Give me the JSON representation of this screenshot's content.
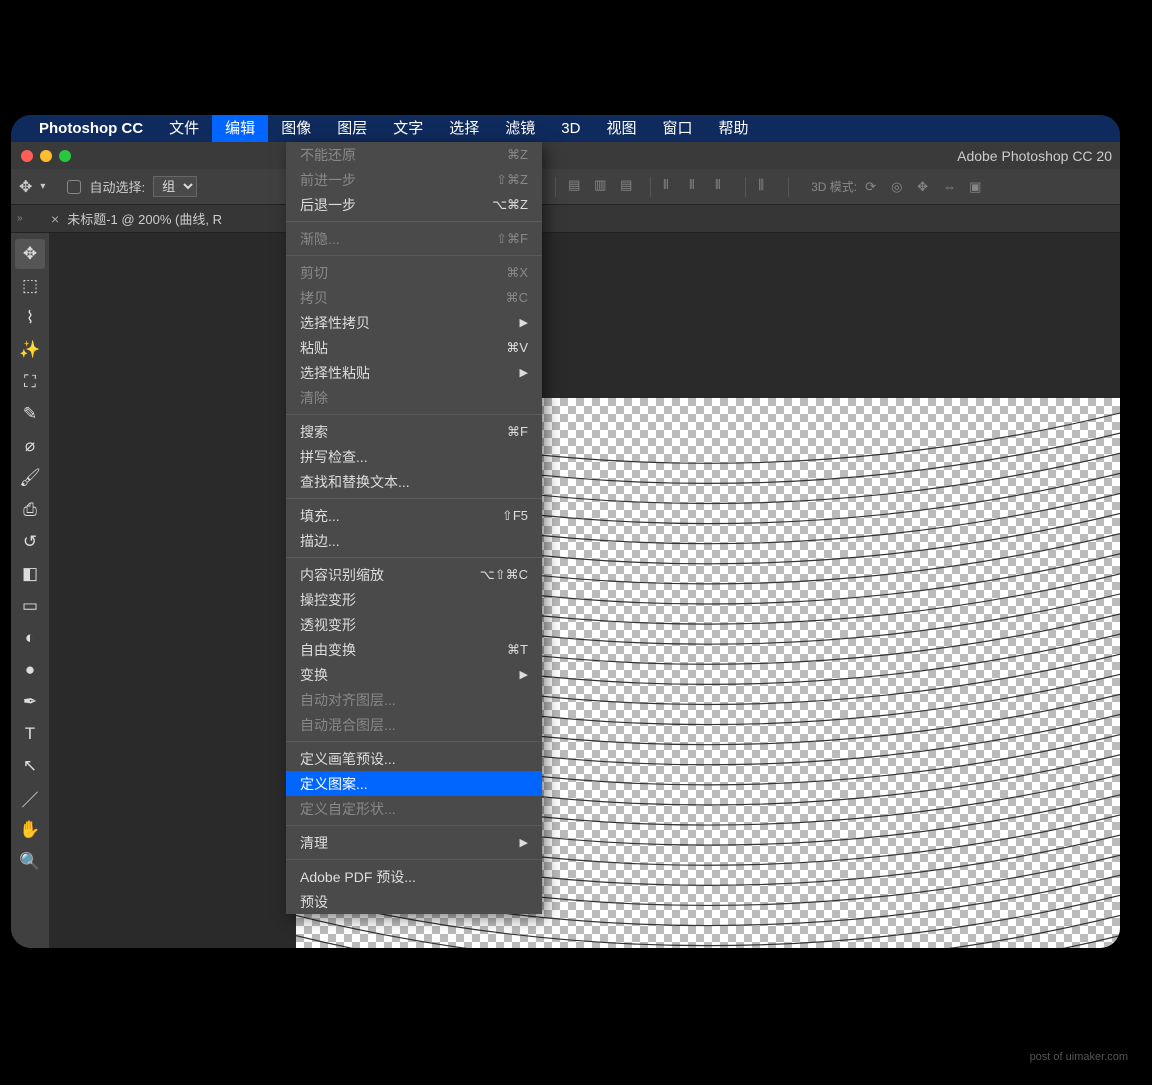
{
  "menubar": {
    "app_name": "Photoshop CC",
    "items": [
      "文件",
      "编辑",
      "图像",
      "图层",
      "文字",
      "选择",
      "滤镜",
      "3D",
      "视图",
      "窗口",
      "帮助"
    ],
    "active_index": 1
  },
  "window": {
    "title": "Adobe Photoshop CC 20"
  },
  "options_bar": {
    "auto_select_label": "自动选择:",
    "group_label": "组",
    "threeD_label": "3D 模式:"
  },
  "tab": {
    "label": "未标题-1 @ 200% (曲线, R"
  },
  "toolbar_icons": [
    "move",
    "marquee",
    "lasso",
    "wand",
    "crop",
    "eyedropper",
    "heal",
    "brush",
    "stamp",
    "history",
    "eraser",
    "gradient",
    "blur",
    "dodge",
    "pen",
    "type",
    "path",
    "shape",
    "hand",
    "zoom"
  ],
  "edit_menu": [
    {
      "section": [
        {
          "label": "不能还原",
          "shortcut": "⌘Z",
          "disabled": true
        },
        {
          "label": "前进一步",
          "shortcut": "⇧⌘Z",
          "disabled": true
        },
        {
          "label": "后退一步",
          "shortcut": "⌥⌘Z"
        }
      ]
    },
    {
      "section": [
        {
          "label": "渐隐...",
          "shortcut": "⇧⌘F",
          "disabled": true
        }
      ]
    },
    {
      "section": [
        {
          "label": "剪切",
          "shortcut": "⌘X",
          "disabled": true
        },
        {
          "label": "拷贝",
          "shortcut": "⌘C",
          "disabled": true
        },
        {
          "label": "选择性拷贝",
          "submenu": true
        },
        {
          "label": "粘贴",
          "shortcut": "⌘V"
        },
        {
          "label": "选择性粘贴",
          "submenu": true
        },
        {
          "label": "清除",
          "disabled": true
        }
      ]
    },
    {
      "section": [
        {
          "label": "搜索",
          "shortcut": "⌘F"
        },
        {
          "label": "拼写检查..."
        },
        {
          "label": "查找和替换文本..."
        }
      ]
    },
    {
      "section": [
        {
          "label": "填充...",
          "shortcut": "⇧F5"
        },
        {
          "label": "描边..."
        }
      ]
    },
    {
      "section": [
        {
          "label": "内容识别缩放",
          "shortcut": "⌥⇧⌘C"
        },
        {
          "label": "操控变形"
        },
        {
          "label": "透视变形"
        },
        {
          "label": "自由变换",
          "shortcut": "⌘T"
        },
        {
          "label": "变换",
          "submenu": true
        },
        {
          "label": "自动对齐图层...",
          "disabled": true
        },
        {
          "label": "自动混合图层...",
          "disabled": true
        }
      ]
    },
    {
      "section": [
        {
          "label": "定义画笔预设..."
        },
        {
          "label": "定义图案...",
          "highlighted": true
        },
        {
          "label": "定义自定形状...",
          "disabled": true
        }
      ]
    },
    {
      "section": [
        {
          "label": "清理",
          "submenu": true
        }
      ]
    },
    {
      "section": [
        {
          "label": "Adobe PDF 预设..."
        },
        {
          "label": "预设"
        }
      ]
    }
  ],
  "watermark": "post of uimaker.com"
}
